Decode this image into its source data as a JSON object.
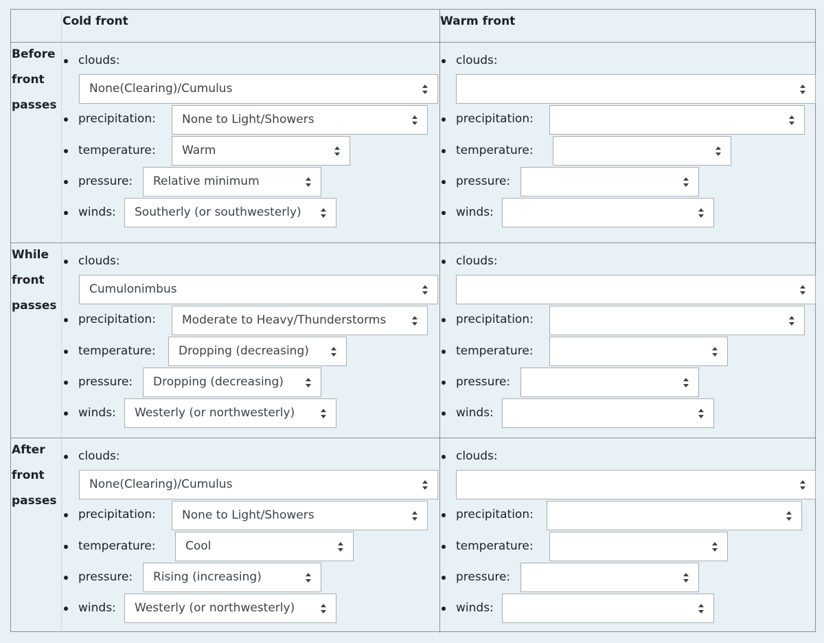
{
  "header": {
    "cold": "Cold front",
    "warm": "Warm front"
  },
  "labels": {
    "clouds": "clouds:",
    "precipitation": "precipitation:",
    "temperature": "temperature:",
    "pressure": "pressure:",
    "winds": "winds:"
  },
  "rows": [
    {
      "label": [
        "Before",
        "front",
        "passes"
      ],
      "cold": {
        "clouds": "None(Clearing)/Cumulus",
        "precipitation": "None to Light/Showers",
        "temperature": "Warm",
        "pressure": "Relative minimum",
        "winds": "Southerly (or southwesterly)"
      },
      "warm": {
        "clouds": "",
        "precipitation": "",
        "temperature": "",
        "pressure": "",
        "winds": ""
      }
    },
    {
      "label": [
        "While",
        "front",
        "passes"
      ],
      "cold": {
        "clouds": "Cumulonimbus",
        "precipitation": "Moderate to Heavy/Thunderstorms",
        "temperature": "Dropping (decreasing)",
        "pressure": "Dropping (decreasing)",
        "winds": "Westerly (or northwesterly)"
      },
      "warm": {
        "clouds": "",
        "precipitation": "",
        "temperature": "",
        "pressure": "",
        "winds": ""
      }
    },
    {
      "label": [
        "After",
        "front",
        "passes"
      ],
      "cold": {
        "clouds": "None(Clearing)/Cumulus",
        "precipitation": "None to Light/Showers",
        "temperature": "Cool",
        "pressure": "Rising (increasing)",
        "winds": "Westerly (or northwesterly)"
      },
      "warm": {
        "clouds": "",
        "precipitation": "",
        "temperature": "",
        "pressure": "",
        "winds": ""
      }
    }
  ]
}
